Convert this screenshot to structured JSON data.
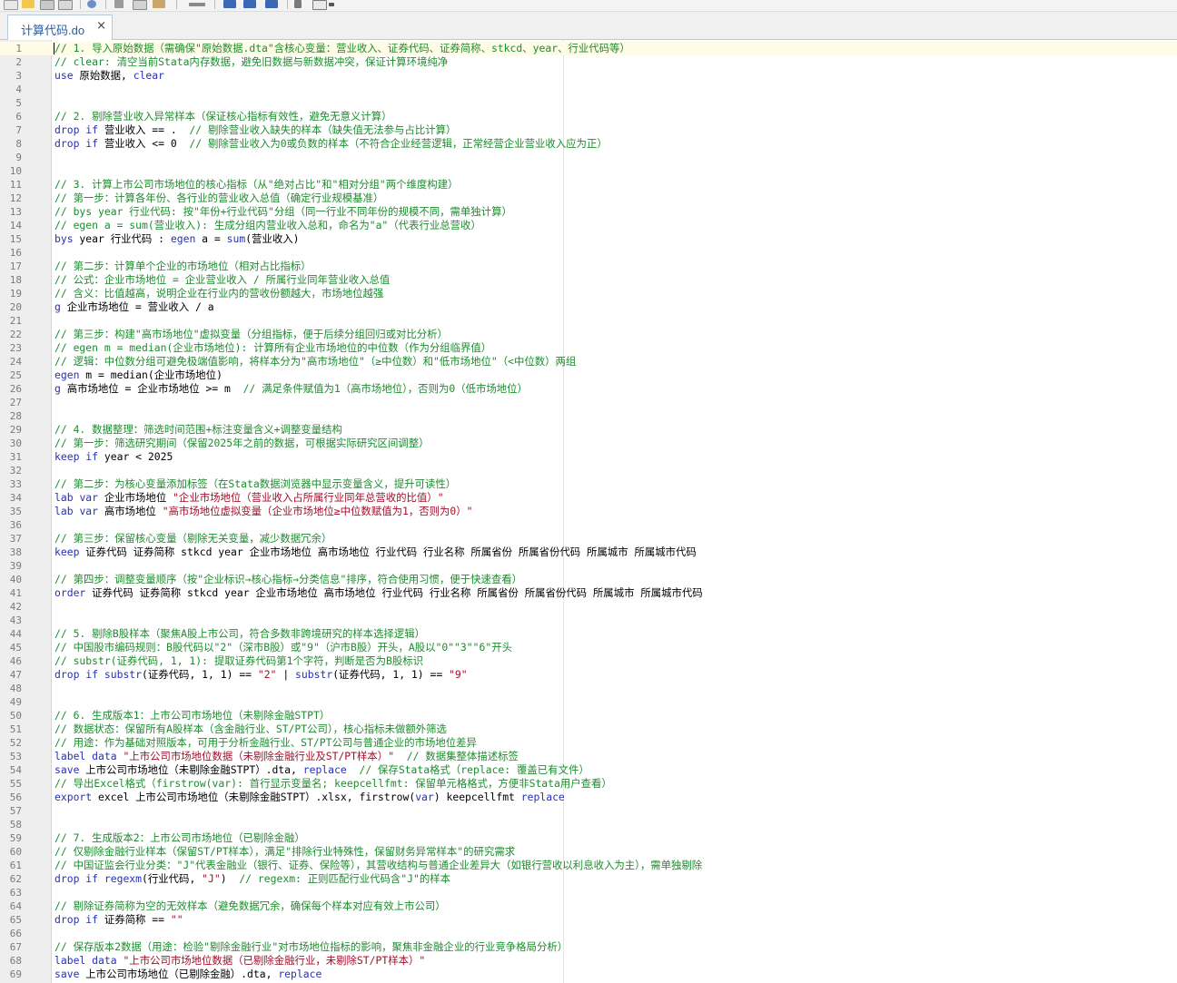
{
  "tab": {
    "title": "计算代码.do",
    "close": "×"
  },
  "toolbar": {
    "icons": [
      "new-file-icon",
      "open-folder-icon",
      "save-icon",
      "print-icon",
      "find-icon",
      "cut-icon",
      "copy-icon",
      "paste-icon",
      "undo-icon",
      "bookmark-icon",
      "bookmark-next-icon",
      "bookmark-prev-icon",
      "indent-icon",
      "run-icon",
      "dropdown-icon"
    ]
  },
  "colors": {
    "comment": "#1d8c2e",
    "keyword": "#2530b8",
    "string": "#a0102a",
    "gutter": "#eeeeee",
    "current_line": "#fefbe6",
    "tab_text": "#2c5d9c"
  },
  "lines": [
    [
      [
        "c",
        "// 1. 导入原始数据（需确保\"原始数据.dta\"含核心变量：营业收入、证券代码、证券简称、stkcd、year、行业代码等）"
      ]
    ],
    [
      [
        "c",
        "// clear: 清空当前Stata内存数据，避免旧数据与新数据冲突，保证计算环境纯净"
      ]
    ],
    [
      [
        "k",
        "use"
      ],
      [
        "p",
        " 原始数据, "
      ],
      [
        "k",
        "clear"
      ]
    ],
    [],
    [],
    [
      [
        "c",
        "// 2. 剔除营业收入异常样本（保证核心指标有效性，避免无意义计算）"
      ]
    ],
    [
      [
        "k",
        "drop"
      ],
      [
        "p",
        " "
      ],
      [
        "k",
        "if"
      ],
      [
        "p",
        " 营业收入 == .  "
      ],
      [
        "c",
        "// 剔除营业收入缺失的样本（缺失值无法参与占比计算）"
      ]
    ],
    [
      [
        "k",
        "drop"
      ],
      [
        "p",
        " "
      ],
      [
        "k",
        "if"
      ],
      [
        "p",
        " 营业收入 <= 0  "
      ],
      [
        "c",
        "// 剔除营业收入为0或负数的样本（不符合企业经营逻辑，正常经营企业营业收入应为正）"
      ]
    ],
    [],
    [],
    [
      [
        "c",
        "// 3. 计算上市公司市场地位的核心指标（从\"绝对占比\"和\"相对分组\"两个维度构建）"
      ]
    ],
    [
      [
        "c",
        "// 第一步：计算各年份、各行业的营业收入总值（确定行业规模基准）"
      ]
    ],
    [
      [
        "c",
        "// bys year 行业代码: 按\"年份+行业代码\"分组（同一行业不同年份的规模不同，需单独计算）"
      ]
    ],
    [
      [
        "c",
        "// egen a = sum(营业收入): 生成分组内营业收入总和，命名为\"a\"（代表行业总营收）"
      ]
    ],
    [
      [
        "k",
        "bys"
      ],
      [
        "p",
        " year 行业代码 : "
      ],
      [
        "k",
        "egen"
      ],
      [
        "p",
        " a = "
      ],
      [
        "k",
        "sum"
      ],
      [
        "p",
        "(营业收入)"
      ]
    ],
    [],
    [
      [
        "c",
        "// 第二步：计算单个企业的市场地位（相对占比指标）"
      ]
    ],
    [
      [
        "c",
        "// 公式：企业市场地位 = 企业营业收入 / 所属行业同年营业收入总值"
      ]
    ],
    [
      [
        "c",
        "// 含义：比值越高，说明企业在行业内的营收份额越大，市场地位越强"
      ]
    ],
    [
      [
        "k",
        "g"
      ],
      [
        "p",
        " 企业市场地位 = 营业收入 / a"
      ]
    ],
    [],
    [
      [
        "c",
        "// 第三步：构建\"高市场地位\"虚拟变量（分组指标，便于后续分组回归或对比分析）"
      ]
    ],
    [
      [
        "c",
        "// egen m = median(企业市场地位): 计算所有企业市场地位的中位数（作为分组临界值）"
      ]
    ],
    [
      [
        "c",
        "// 逻辑：中位数分组可避免极端值影响，将样本分为\"高市场地位\"（≥中位数）和\"低市场地位\"（<中位数）两组"
      ]
    ],
    [
      [
        "k",
        "egen"
      ],
      [
        "p",
        " m = median(企业市场地位)"
      ]
    ],
    [
      [
        "k",
        "g"
      ],
      [
        "p",
        " 高市场地位 = 企业市场地位 >= m  "
      ],
      [
        "c",
        "// 满足条件赋值为1（高市场地位），否则为0（低市场地位）"
      ]
    ],
    [],
    [],
    [
      [
        "c",
        "// 4. 数据整理：筛选时间范围+标注变量含义+调整变量结构"
      ]
    ],
    [
      [
        "c",
        "// 第一步：筛选研究期间（保留2025年之前的数据，可根据实际研究区间调整）"
      ]
    ],
    [
      [
        "k",
        "keep"
      ],
      [
        "p",
        " "
      ],
      [
        "k",
        "if"
      ],
      [
        "p",
        " year < 2025"
      ]
    ],
    [],
    [
      [
        "c",
        "// 第二步：为核心变量添加标签（在Stata数据浏览器中显示变量含义，提升可读性）"
      ]
    ],
    [
      [
        "k",
        "lab"
      ],
      [
        "p",
        " "
      ],
      [
        "k",
        "var"
      ],
      [
        "p",
        " 企业市场地位 "
      ],
      [
        "s",
        "\"企业市场地位（营业收入占所属行业同年总营收的比值）\""
      ]
    ],
    [
      [
        "k",
        "lab"
      ],
      [
        "p",
        " "
      ],
      [
        "k",
        "var"
      ],
      [
        "p",
        " 高市场地位 "
      ],
      [
        "s",
        "\"高市场地位虚拟变量（企业市场地位≥中位数赋值为1，否则为0）\""
      ]
    ],
    [],
    [
      [
        "c",
        "// 第三步：保留核心变量（剔除无关变量，减少数据冗余）"
      ]
    ],
    [
      [
        "k",
        "keep"
      ],
      [
        "p",
        " 证券代码 证券简称 stkcd year 企业市场地位 高市场地位 行业代码 行业名称 所属省份 所属省份代码 所属城市 所属城市代码"
      ]
    ],
    [],
    [
      [
        "c",
        "// 第四步：调整变量顺序（按\"企业标识→核心指标→分类信息\"排序，符合使用习惯，便于快速查看）"
      ]
    ],
    [
      [
        "k",
        "order"
      ],
      [
        "p",
        " 证券代码 证券简称 stkcd year 企业市场地位 高市场地位 行业代码 行业名称 所属省份 所属省份代码 所属城市 所属城市代码"
      ]
    ],
    [],
    [],
    [
      [
        "c",
        "// 5. 剔除B股样本（聚焦A股上市公司，符合多数非跨境研究的样本选择逻辑）"
      ]
    ],
    [
      [
        "c",
        "// 中国股市编码规则：B股代码以\"2\"（深市B股）或\"9\"（沪市B股）开头，A股以\"0\"\"3\"\"6\"开头"
      ]
    ],
    [
      [
        "c",
        "// substr(证券代码, 1, 1): 提取证券代码第1个字符，判断是否为B股标识"
      ]
    ],
    [
      [
        "k",
        "drop"
      ],
      [
        "p",
        " "
      ],
      [
        "k",
        "if"
      ],
      [
        "p",
        " "
      ],
      [
        "k",
        "substr"
      ],
      [
        "p",
        "(证券代码, 1, 1) == "
      ],
      [
        "s",
        "\"2\""
      ],
      [
        "p",
        " | "
      ],
      [
        "k",
        "substr"
      ],
      [
        "p",
        "(证券代码, 1, 1) == "
      ],
      [
        "s",
        "\"9\""
      ]
    ],
    [],
    [],
    [
      [
        "c",
        "// 6. 生成版本1：上市公司市场地位（未剔除金融STPT）"
      ]
    ],
    [
      [
        "c",
        "// 数据状态：保留所有A股样本（含金融行业、ST/PT公司），核心指标未做额外筛选"
      ]
    ],
    [
      [
        "c",
        "// 用途：作为基础对照版本，可用于分析金融行业、ST/PT公司与普通企业的市场地位差异"
      ]
    ],
    [
      [
        "k",
        "label"
      ],
      [
        "p",
        " "
      ],
      [
        "k",
        "data"
      ],
      [
        "p",
        " "
      ],
      [
        "s",
        "\"上市公司市场地位数据（未剔除金融行业及ST/PT样本）\""
      ],
      [
        "p",
        "  "
      ],
      [
        "c",
        "// 数据集整体描述标签"
      ]
    ],
    [
      [
        "k",
        "save"
      ],
      [
        "p",
        " 上市公司市场地位（未剔除金融STPT）.dta, "
      ],
      [
        "k",
        "replace"
      ],
      [
        "p",
        "  "
      ],
      [
        "c",
        "// 保存Stata格式（replace: 覆盖已有文件）"
      ]
    ],
    [
      [
        "c",
        "// 导出Excel格式（firstrow(var): 首行显示变量名; keepcellfmt: 保留单元格格式，方便非Stata用户查看）"
      ]
    ],
    [
      [
        "k",
        "export"
      ],
      [
        "p",
        " excel 上市公司市场地位（未剔除金融STPT）.xlsx, firstrow("
      ],
      [
        "k",
        "var"
      ],
      [
        "p",
        ") keepcellfmt "
      ],
      [
        "k",
        "replace"
      ]
    ],
    [],
    [],
    [
      [
        "c",
        "// 7. 生成版本2：上市公司市场地位（已剔除金融）"
      ]
    ],
    [
      [
        "c",
        "// 仅剔除金融行业样本（保留ST/PT样本），满足\"排除行业特殊性，保留财务异常样本\"的研究需求"
      ]
    ],
    [
      [
        "c",
        "// 中国证监会行业分类：\"J\"代表金融业（银行、证券、保险等），其营收结构与普通企业差异大（如银行营收以利息收入为主），需单独剔除"
      ]
    ],
    [
      [
        "k",
        "drop"
      ],
      [
        "p",
        " "
      ],
      [
        "k",
        "if"
      ],
      [
        "p",
        " "
      ],
      [
        "k",
        "regexm"
      ],
      [
        "p",
        "(行业代码, "
      ],
      [
        "s",
        "\"J\""
      ],
      [
        "p",
        ")  "
      ],
      [
        "c",
        "// regexm: 正则匹配行业代码含\"J\"的样本"
      ]
    ],
    [],
    [
      [
        "c",
        "// 剔除证券简称为空的无效样本（避免数据冗余，确保每个样本对应有效上市公司）"
      ]
    ],
    [
      [
        "k",
        "drop"
      ],
      [
        "p",
        " "
      ],
      [
        "k",
        "if"
      ],
      [
        "p",
        " 证券简称 == "
      ],
      [
        "s",
        "\"\""
      ]
    ],
    [],
    [
      [
        "c",
        "// 保存版本2数据（用途：检验\"剔除金融行业\"对市场地位指标的影响，聚焦非金融企业的行业竞争格局分析）"
      ]
    ],
    [
      [
        "k",
        "label"
      ],
      [
        "p",
        " "
      ],
      [
        "k",
        "data"
      ],
      [
        "p",
        " "
      ],
      [
        "s",
        "\"上市公司市场地位数据（已剔除金融行业，未剔除ST/PT样本）\""
      ]
    ],
    [
      [
        "k",
        "save"
      ],
      [
        "p",
        " 上市公司市场地位（已剔除金融）.dta, "
      ],
      [
        "k",
        "replace"
      ]
    ]
  ]
}
